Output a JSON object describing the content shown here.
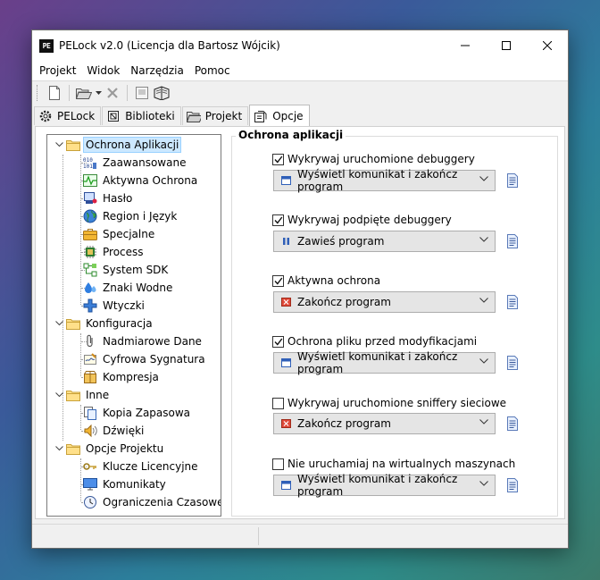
{
  "window": {
    "title": "PELock v2.0 (Licencja dla Bartosz Wójcik)",
    "logo_text": "PE"
  },
  "menu": [
    "Projekt",
    "Widok",
    "Narzędzia",
    "Pomoc"
  ],
  "tabs": [
    {
      "label": "PELock",
      "icon": "gear-icon"
    },
    {
      "label": "Biblioteki",
      "icon": "library-icon"
    },
    {
      "label": "Projekt",
      "icon": "folder-open-icon"
    },
    {
      "label": "Opcje",
      "icon": "options-icon",
      "active": true
    }
  ],
  "tree": {
    "groups": [
      {
        "label": "Ochrona Aplikacji",
        "selected": true,
        "items": [
          {
            "label": "Zaawansowane",
            "icon": "binary-icon"
          },
          {
            "label": "Aktywna Ochrona",
            "icon": "pulse-icon"
          },
          {
            "label": "Hasło",
            "icon": "password-icon"
          },
          {
            "label": "Region i Język",
            "icon": "globe-icon"
          },
          {
            "label": "Specjalne",
            "icon": "briefcase-icon"
          },
          {
            "label": "Process",
            "icon": "chip-icon"
          },
          {
            "label": "System SDK",
            "icon": "sdk-icon"
          },
          {
            "label": "Znaki Wodne",
            "icon": "water-drop-icon"
          },
          {
            "label": "Wtyczki",
            "icon": "plus-icon"
          }
        ]
      },
      {
        "label": "Konfiguracja",
        "items": [
          {
            "label": "Nadmiarowe Dane",
            "icon": "paperclip-icon"
          },
          {
            "label": "Cyfrowa Sygnatura",
            "icon": "signature-icon"
          },
          {
            "label": "Kompresja",
            "icon": "package-icon"
          }
        ]
      },
      {
        "label": "Inne",
        "items": [
          {
            "label": "Kopia Zapasowa",
            "icon": "copy-icon"
          },
          {
            "label": "Dźwięki",
            "icon": "speaker-icon"
          }
        ]
      },
      {
        "label": "Opcje Projektu",
        "items": [
          {
            "label": "Klucze Licencyjne",
            "icon": "key-icon"
          },
          {
            "label": "Komunikaty",
            "icon": "monitor-icon"
          },
          {
            "label": "Ograniczenia Czasowe",
            "icon": "clock-icon"
          }
        ]
      }
    ]
  },
  "options_panel": {
    "title": "Ochrona aplikacji",
    "options": [
      {
        "label": "Wykrywaj uruchomione debuggery",
        "checked": true,
        "action": "Wyświetl komunikat i zakończ program",
        "action_icon": "message-icon"
      },
      {
        "label": "Wykrywaj podpięte debuggery",
        "checked": true,
        "action": "Zawieś program",
        "action_icon": "pause-icon"
      },
      {
        "label": "Aktywna ochrona",
        "checked": true,
        "action": "Zakończ program",
        "action_icon": "terminate-icon"
      },
      {
        "label": "Ochrona pliku przed modyfikacjami",
        "checked": true,
        "action": "Wyświetl komunikat i zakończ program",
        "action_icon": "message-icon"
      },
      {
        "label": "Wykrywaj uruchomione sniffery sieciowe",
        "checked": false,
        "action": "Zakończ program",
        "action_icon": "terminate-icon"
      },
      {
        "label": "Nie uruchamiaj na wirtualnych maszynach",
        "checked": false,
        "action": "Wyświetl komunikat i zakończ program",
        "action_icon": "message-icon"
      }
    ]
  }
}
